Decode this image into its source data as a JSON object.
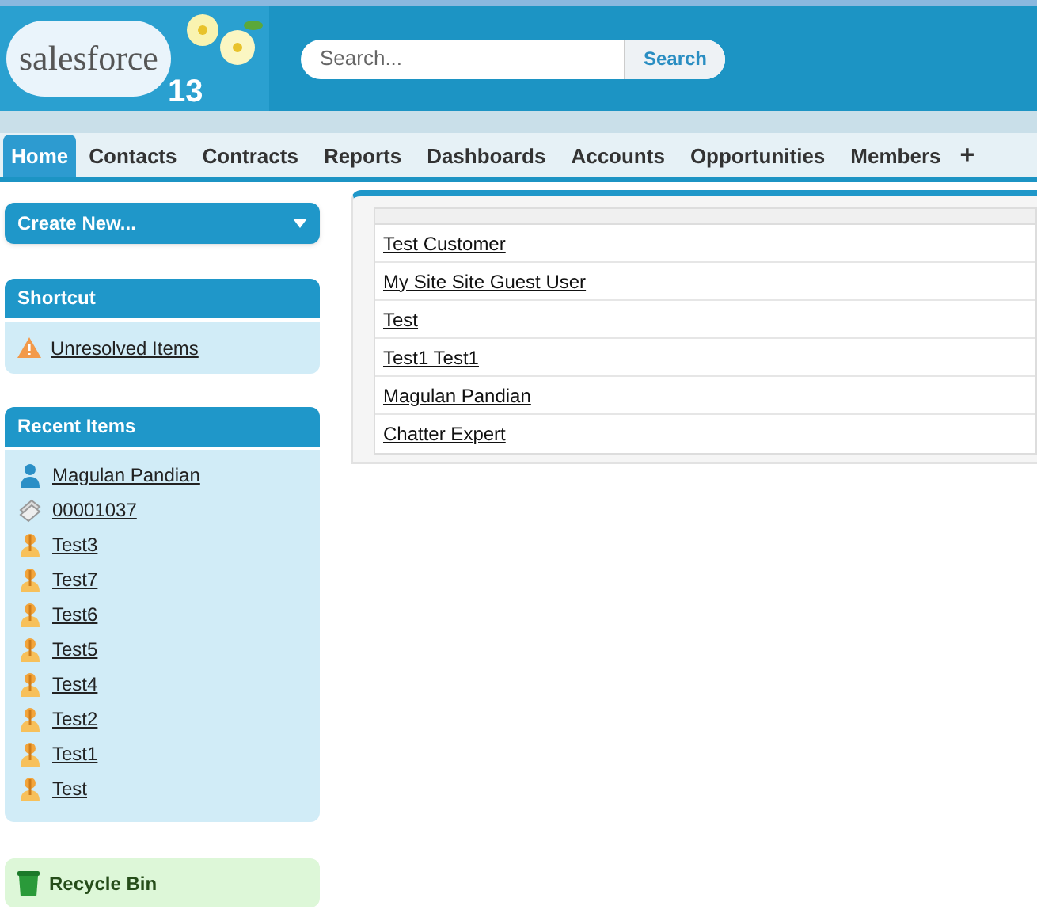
{
  "logo": {
    "brand": "salesforce",
    "release": "13"
  },
  "search": {
    "placeholder": "Search...",
    "button": "Search"
  },
  "tabs": [
    {
      "label": "Home",
      "selected": true
    },
    {
      "label": "Contacts",
      "selected": false
    },
    {
      "label": "Contracts",
      "selected": false
    },
    {
      "label": "Reports",
      "selected": false
    },
    {
      "label": "Dashboards",
      "selected": false
    },
    {
      "label": "Accounts",
      "selected": false
    },
    {
      "label": "Opportunities",
      "selected": false
    },
    {
      "label": "Members",
      "selected": false
    }
  ],
  "more_tabs": "+",
  "create_new": "Create New...",
  "shortcut": {
    "title": "Shortcut",
    "items": [
      "Unresolved Items"
    ]
  },
  "recent_items": {
    "title": "Recent Items",
    "items": [
      {
        "label": "Magulan Pandian",
        "kind": "person"
      },
      {
        "label": "00001037",
        "kind": "case"
      },
      {
        "label": "Test3",
        "kind": "lead"
      },
      {
        "label": "Test7",
        "kind": "lead"
      },
      {
        "label": "Test6",
        "kind": "lead"
      },
      {
        "label": "Test5",
        "kind": "lead"
      },
      {
        "label": "Test4",
        "kind": "lead"
      },
      {
        "label": "Test2",
        "kind": "lead"
      },
      {
        "label": "Test1",
        "kind": "lead"
      },
      {
        "label": "Test",
        "kind": "lead"
      }
    ]
  },
  "recycle_bin": "Recycle Bin",
  "table": {
    "rows": [
      "Test Customer",
      "My Site Site Guest User",
      "Test",
      "Test1 Test1",
      "Magulan Pandian",
      "Chatter Expert"
    ]
  }
}
